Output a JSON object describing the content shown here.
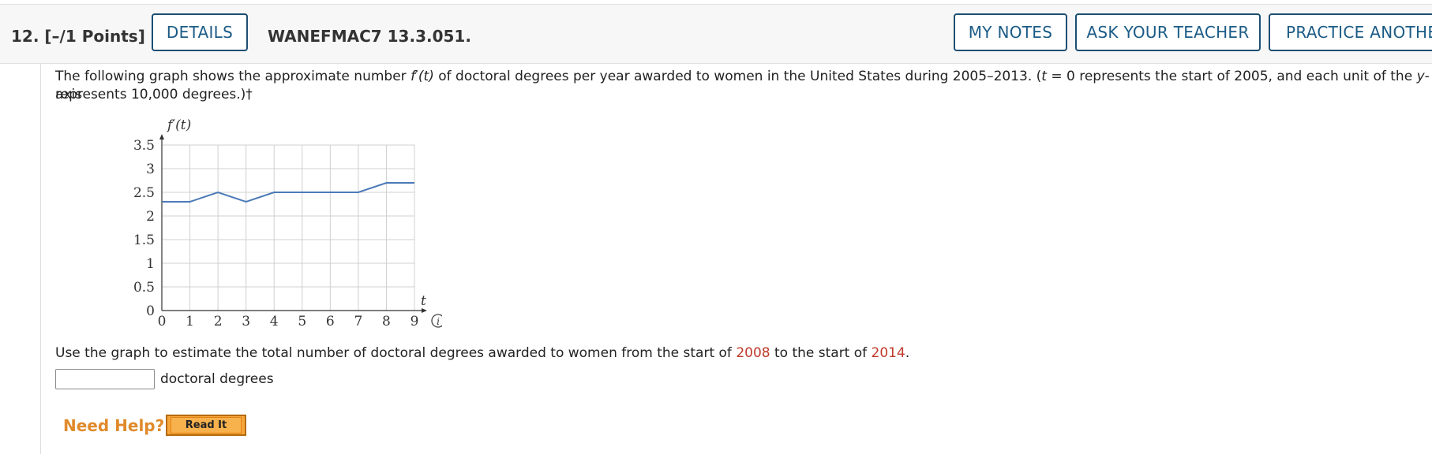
{
  "header": {
    "question_number": "12.",
    "points": "[–/1 Points]",
    "details_label": "DETAILS",
    "problem_code": "WANEFMAC7 13.3.051.",
    "my_notes_label": "MY NOTES",
    "ask_teacher_label": "ASK YOUR TEACHER",
    "practice_label": "PRACTICE ANOTHER"
  },
  "question": {
    "intro_a": "The following graph shows the approximate number ",
    "intro_fn": "f′(t)",
    "intro_b": " of doctoral degrees per year awarded to women in the United States during 2005–2013. (",
    "intro_t": "t",
    "intro_c": " = 0 represents the start of 2005, and each unit of the ",
    "intro_y": "y",
    "intro_d": "-axis",
    "intro_line2": "represents 10,000 degrees.)†",
    "prompt_a": "Use the graph to estimate the total number of doctoral degrees awarded to women from the start of ",
    "year_start": "2008",
    "prompt_b": " to the start of ",
    "year_end": "2014",
    "prompt_c": ".",
    "answer_value": "",
    "answer_unit": "doctoral degrees"
  },
  "help": {
    "need_help": "Need Help?",
    "read_it": "Read It"
  },
  "colors": {
    "line": "#4a7ab8",
    "grid": "#d0d0d0",
    "button_text": "#1b5b86",
    "highlight": "#c0392b"
  },
  "chart_data": {
    "type": "line",
    "ylabel": "f′(t)",
    "xlabel": "t",
    "xlim": [
      0,
      9
    ],
    "ylim": [
      0,
      3.5
    ],
    "grid": true,
    "x_ticks": [
      "0",
      "1",
      "2",
      "3",
      "4",
      "5",
      "6",
      "7",
      "8",
      "9"
    ],
    "y_ticks": [
      "0",
      "0.5",
      "1",
      "1.5",
      "2",
      "2.5",
      "3",
      "3.5"
    ],
    "series": [
      {
        "x": [
          0,
          1,
          2,
          3,
          4,
          5,
          6,
          7,
          8,
          9
        ],
        "y": [
          2.3,
          2.3,
          2.5,
          2.3,
          2.5,
          2.5,
          2.5,
          2.5,
          2.7,
          2.7
        ]
      }
    ],
    "info_icon": "info-icon"
  }
}
